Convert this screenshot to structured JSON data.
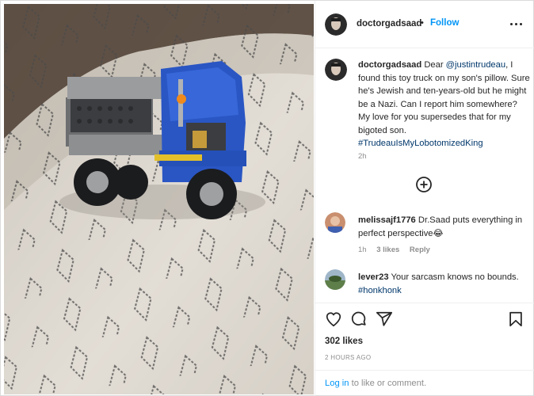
{
  "header": {
    "username": "doctorgadsaad",
    "separator": "•",
    "follow_label": "Follow"
  },
  "caption": {
    "username": "doctorgadsaad",
    "text_before": "Dear ",
    "mention": "@justintrudeau",
    "text_after": ", I found this toy truck on my son's pillow. Sure he's Jewish and ten-years-old but he might be a Nazi. Can I report him somewhere? My love for you supersedes that for my bigoted son.",
    "hashtag": "#TrudeauIsMyLobotomizedKing",
    "age": "2h"
  },
  "comments": [
    {
      "username": "melissajf1776",
      "text": "Dr.Saad puts everything in perfect perspective",
      "emoji": "😂",
      "age": "1h",
      "likes": "3 likes",
      "reply_label": "Reply"
    },
    {
      "username": "lever23",
      "text": "Your sarcasm knows no bounds.",
      "hashtag": "#honkhonk"
    }
  ],
  "actions": {
    "icons": [
      "heart-icon",
      "comment-icon",
      "share-icon",
      "bookmark-icon"
    ]
  },
  "likes_text": "302 likes",
  "timestamp": "2 HOURS AGO",
  "footer": {
    "login_label": "Log in",
    "rest": " to like or comment."
  },
  "colors": {
    "accent": "#0095f6",
    "link": "#00376b",
    "muted": "#8e8e8e",
    "text": "#262626"
  }
}
